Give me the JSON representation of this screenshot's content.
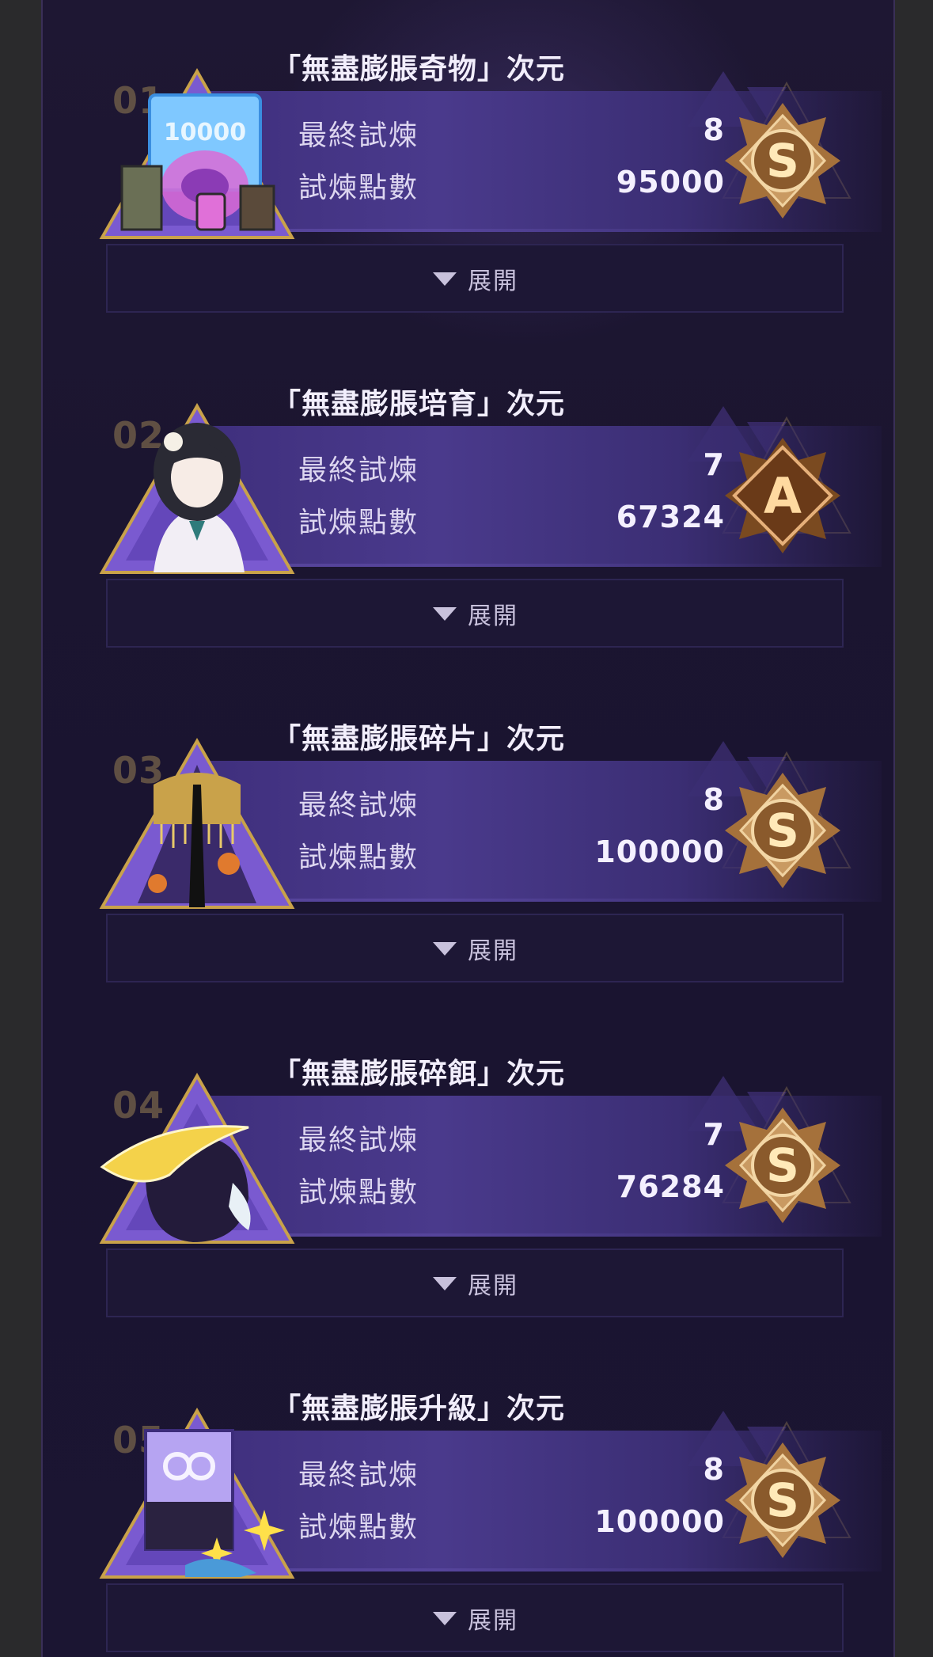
{
  "dimensions": [
    {
      "index": "01",
      "title": "「無盡膨脹奇物」次元",
      "rows": [
        {
          "label": "最終試煉",
          "value": "8"
        },
        {
          "label": "試煉點數",
          "value": "95000"
        }
      ],
      "grade": "S",
      "expand_label": "展開",
      "art": "artifact-icon"
    },
    {
      "index": "02",
      "title": "「無盡膨脹培育」次元",
      "rows": [
        {
          "label": "最終試煉",
          "value": "7"
        },
        {
          "label": "試煉點數",
          "value": "67324"
        }
      ],
      "grade": "A",
      "expand_label": "展開",
      "art": "character-portrait-icon"
    },
    {
      "index": "03",
      "title": "「無盡膨脹碎片」次元",
      "rows": [
        {
          "label": "最終試煉",
          "value": "8"
        },
        {
          "label": "試煉點數",
          "value": "100000"
        }
      ],
      "grade": "S",
      "expand_label": "展開",
      "art": "shard-icon"
    },
    {
      "index": "04",
      "title": "「無盡膨脹碎餌」次元",
      "rows": [
        {
          "label": "最終試煉",
          "value": "7"
        },
        {
          "label": "試煉點數",
          "value": "76284"
        }
      ],
      "grade": "S",
      "expand_label": "展開",
      "art": "bait-icon"
    },
    {
      "index": "05",
      "title": "「無盡膨脹升級」次元",
      "rows": [
        {
          "label": "最終試煉",
          "value": "8"
        },
        {
          "label": "試煉點數",
          "value": "100000"
        }
      ],
      "grade": "S",
      "expand_label": "展開",
      "art": "upgrade-book-icon"
    }
  ],
  "colors": {
    "panel_bg": "#1b1530",
    "band": "#4a3a8c",
    "emblem_gold": "#e8b97a",
    "emblem_dark": "#8a5a2c"
  }
}
